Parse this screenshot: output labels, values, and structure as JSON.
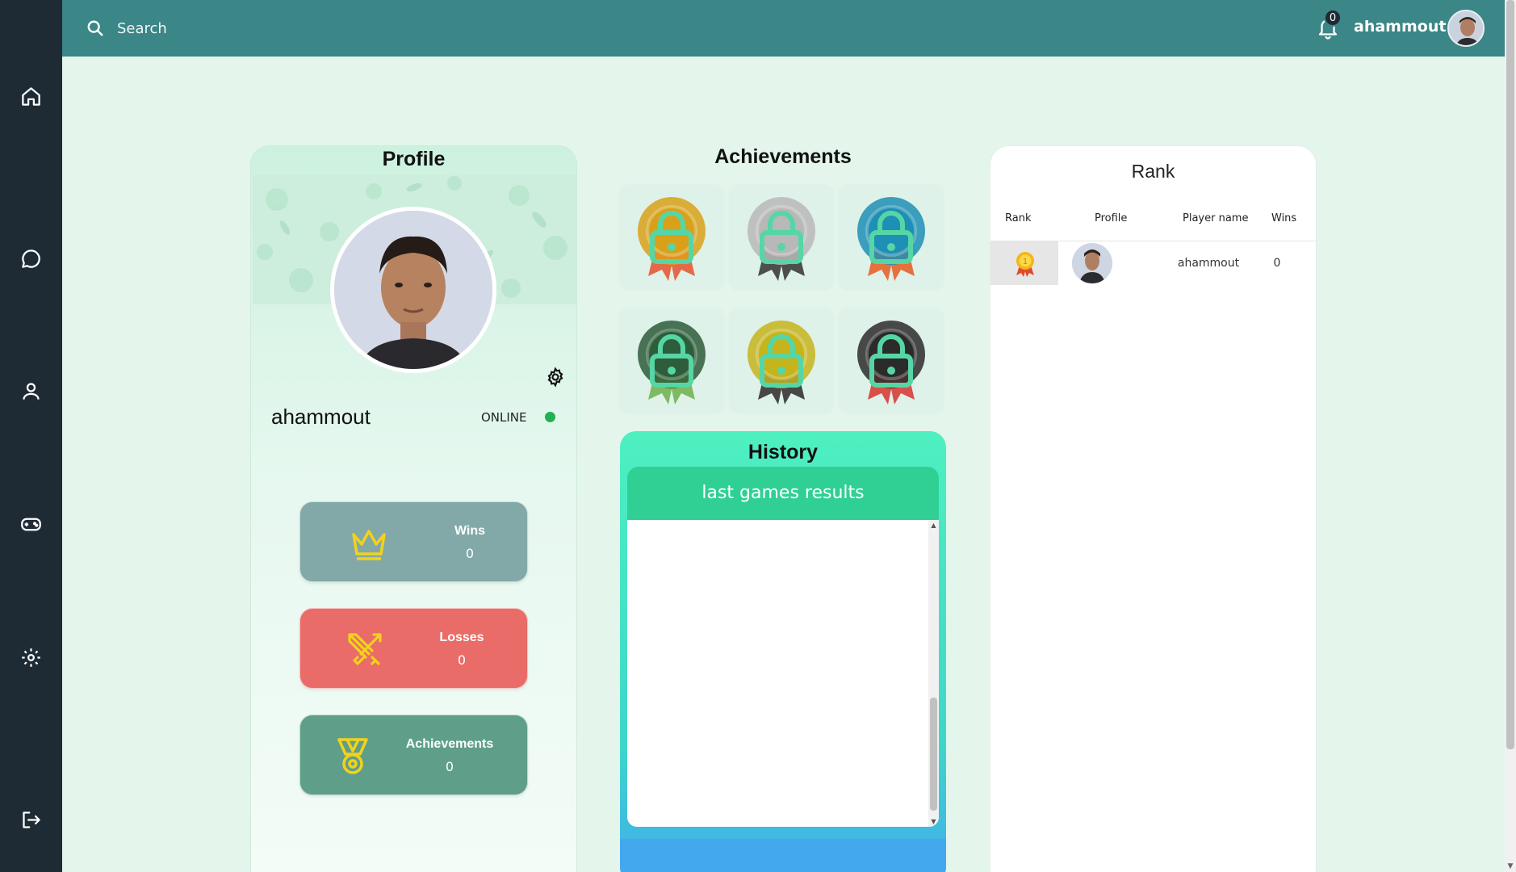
{
  "search": {
    "placeholder": "Search"
  },
  "header": {
    "notification_count": "0",
    "username": "ahammout"
  },
  "sidebar": {
    "items": [
      {
        "icon": "home-icon"
      },
      {
        "icon": "chat-icon"
      },
      {
        "icon": "user-icon"
      },
      {
        "icon": "gamepad-icon"
      },
      {
        "icon": "settings-icon"
      },
      {
        "icon": "logout-icon"
      }
    ]
  },
  "profile": {
    "title": "Profile",
    "name": "ahammout",
    "status": "ONLINE",
    "status_color": "#1fb154",
    "stats": [
      {
        "label": "Wins",
        "value": "0",
        "icon": "crown-icon",
        "color": "#82a9a8"
      },
      {
        "label": "Losses",
        "value": "0",
        "icon": "swords-icon",
        "color": "#e96c68"
      },
      {
        "label": "Achievements",
        "value": "0",
        "icon": "medal-icon",
        "color": "#5f9f8a"
      }
    ]
  },
  "achievements": {
    "title": "Achievements",
    "badges": [
      {
        "name": "gold",
        "color": "#d9a11a",
        "ribbon": "#e5512d",
        "locked": true
      },
      {
        "name": "silver",
        "color": "#b8b8b8",
        "ribbon": "#333333",
        "locked": true
      },
      {
        "name": "blue",
        "color": "#1e8fb5",
        "ribbon": "#e85b1f",
        "locked": true
      },
      {
        "name": "green",
        "color": "#2d5d3a",
        "ribbon": "#6cb04a",
        "locked": true
      },
      {
        "name": "yellow",
        "color": "#c6b41c",
        "ribbon": "#2a2a2a",
        "locked": true
      },
      {
        "name": "black",
        "color": "#2b2b2b",
        "ribbon": "#d8322e",
        "locked": true
      }
    ]
  },
  "history": {
    "title": "History",
    "subtitle": "last games results"
  },
  "rank": {
    "title": "Rank",
    "columns": [
      "Rank",
      "Profile",
      "Player name",
      "Wins"
    ],
    "rows": [
      {
        "rank": "1",
        "player_name": "ahammout",
        "wins": "0"
      }
    ]
  }
}
